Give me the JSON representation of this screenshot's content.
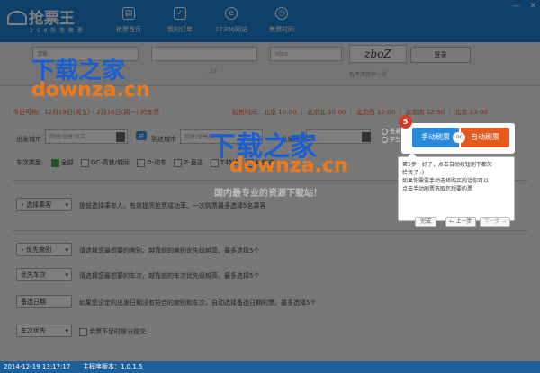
{
  "app": {
    "title": "抢票王",
    "subtitle": "2 5 8 热 悲 聚 票"
  },
  "nav": [
    {
      "label": "抢票首页",
      "icon": "train-icon"
    },
    {
      "label": "我的订单",
      "icon": "checklist-icon"
    },
    {
      "label": "12306网站",
      "icon": "web-icon"
    },
    {
      "label": "售票时间",
      "icon": "clock-icon"
    }
  ],
  "window": {
    "min": "—",
    "close": "✕"
  },
  "login": {
    "user_placeholder": "请输...",
    "pass_placeholder": "",
    "captcha_field": "",
    "captcha_hint": "3Bbz",
    "captcha_image": "zboZ",
    "login_button": "登录",
    "cant_see": "看不清楚换一张",
    "remember": "...SY"
  },
  "dates": {
    "presale": "今日可购：12月19日(周五) - 2月16日(周一) 的车票",
    "schedule": "起售时间：北京 10:00 ｜ 北京北 10:00 ｜ 北京西 12:00 ｜ 北京南 12:30 ｜ 北京 13:00"
  },
  "search": {
    "from_label": "出发城市",
    "from_placeholder": "简拼/全拼/汉字",
    "to_label": "到达城市",
    "to_placeholder": "简拼/全拼/汉字",
    "depart_label": "出发日期",
    "date_value": "2..."
  },
  "train_types": {
    "label": "车次类型:",
    "options": [
      {
        "label": "全部",
        "checked": true
      },
      {
        "label": "GC-高铁/城际",
        "checked": false
      },
      {
        "label": "D-动车",
        "checked": false
      },
      {
        "label": "Z-直达",
        "checked": false
      },
      {
        "label": "T-特快",
        "checked": false
      },
      {
        "label": "K-快速",
        "checked": false
      }
    ]
  },
  "radios": [
    "普通",
    "学生"
  ],
  "options": [
    {
      "button": "选择乘客",
      "desc": "提前选择乘车人，有效提高抢票成功率。一次购票最多选择5名乘客",
      "dot": true
    },
    {
      "button": "优先席别",
      "desc": "请选择您最想要的席别，越靠前的席别优先级越高，最多选择5个",
      "dot": true
    },
    {
      "button": "优先车次",
      "desc": "请选择您最想要的车次，越靠前的车次优先级越高，最多选择5个",
      "dot": false
    },
    {
      "button": "备选日期",
      "desc": "如果您设定的出发日期没有符合的席别和车次，自动选择备选日期的票，最多选择5个",
      "dot": false
    },
    {
      "button": "车次优先",
      "desc": "余票不足时部分提交",
      "dot": false
    }
  ],
  "guide": {
    "step": "5",
    "manual": "手动刷票",
    "or": "or",
    "auto": "自动刷票",
    "lines": [
      "第5步：好了，点击自动按钮刷下都欠",
      "给我了 :)",
      "如果你需要手动选择购买的话你可以",
      "点击手动刷票选取您想要的票"
    ],
    "btn_done": "完成",
    "btn_prev": "← 上一步",
    "btn_next": "下一步 →"
  },
  "watermark": {
    "cn": "下载之家",
    "en": "downza.cn",
    "slogan": "国内最专业的资源下载站！",
    "color_cn": "#1a5fd0",
    "color_en": "#f07a1a"
  },
  "status": {
    "time": "2014-12-19 13:17:17",
    "version": "主程序版本：1.0.1.5"
  }
}
